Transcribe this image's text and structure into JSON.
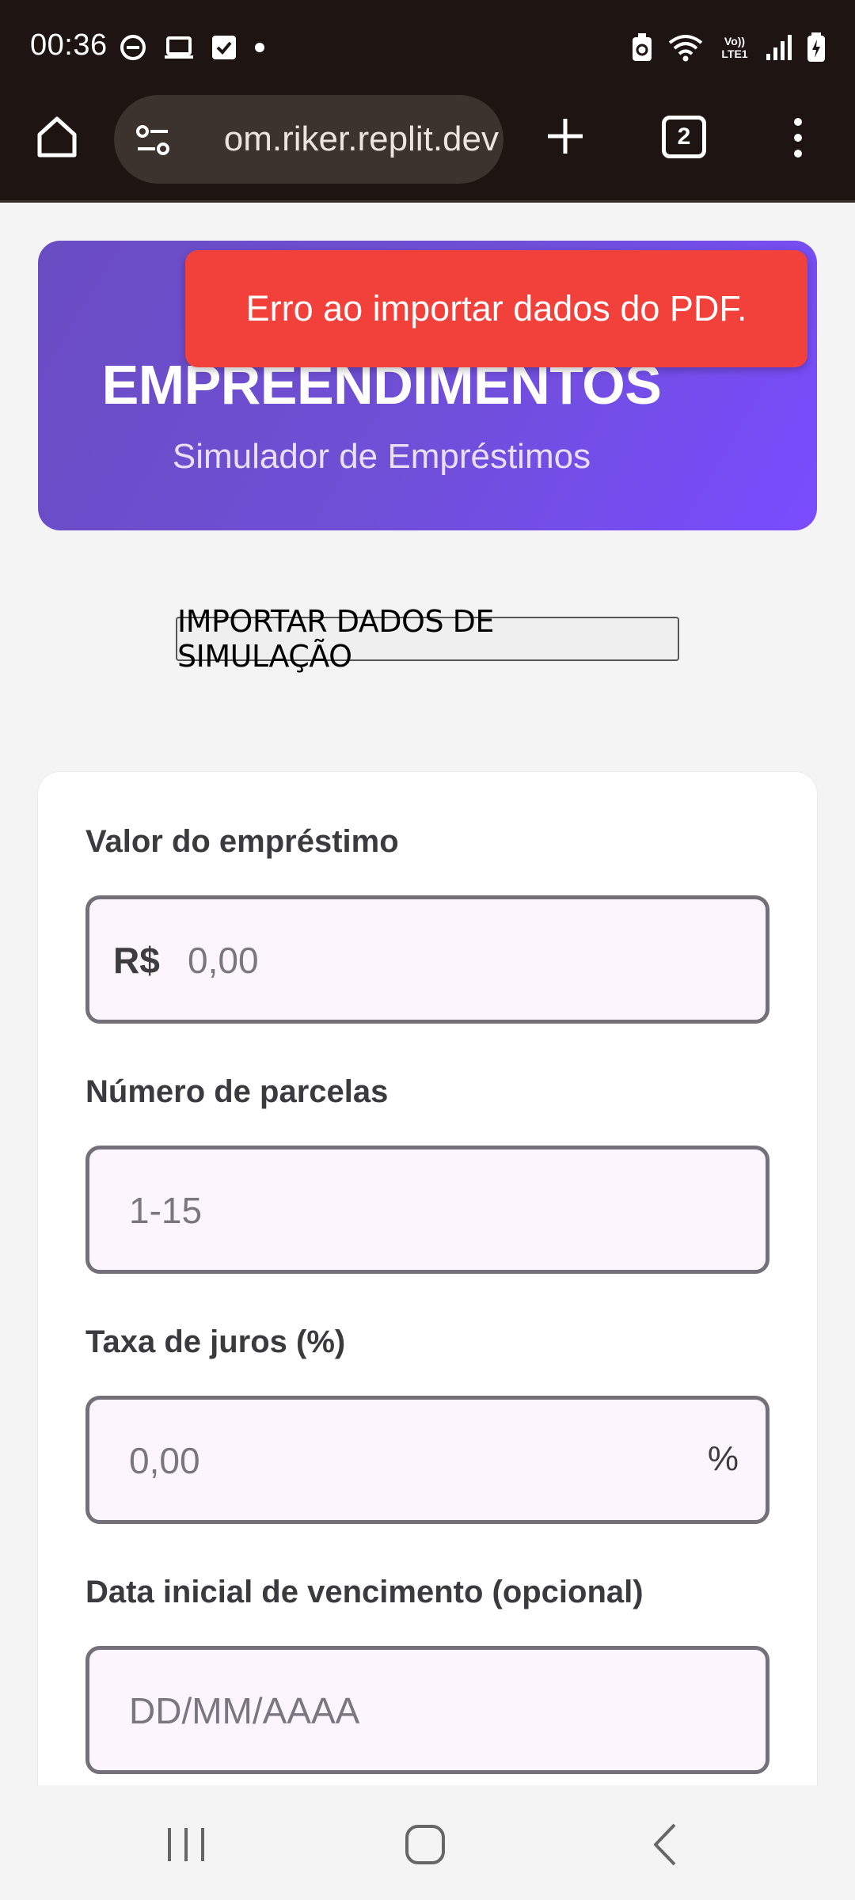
{
  "status_bar": {
    "time": "00:36",
    "left_icons": [
      "do-not-disturb-icon",
      "laptop-icon",
      "checkbox-icon",
      "dot-icon"
    ],
    "right_icons": [
      "battery-saver-icon",
      "wifi-icon",
      "volte-icon",
      "signal-icon",
      "battery-icon"
    ],
    "volte_label": "Vo)) LTE1"
  },
  "browser": {
    "url": "om.riker.replit.dev",
    "tab_count": "2"
  },
  "hero": {
    "title": "EMPREENDIMENTOS",
    "subtitle": "Simulador de Empréstimos"
  },
  "toast": {
    "message": "Erro ao importar dados do PDF."
  },
  "import_button": {
    "label": "IMPORTAR DADOS DE SIMULAÇÃO"
  },
  "form": {
    "loan_value": {
      "label": "Valor do empréstimo",
      "prefix": "R$",
      "placeholder": "0,00"
    },
    "installments": {
      "label": "Número de parcelas",
      "placeholder": "1-15"
    },
    "interest": {
      "label": "Taxa de juros (%)",
      "placeholder": "0,00",
      "suffix": "%"
    },
    "due_date": {
      "label": "Data inicial de vencimento (opcional)",
      "placeholder": "DD/MM/AAAA"
    }
  },
  "colors": {
    "hero_gradient_start": "#6a4cc2",
    "hero_gradient_end": "#7a4cff",
    "toast_background": "#f2413a",
    "input_background": "#fdf5fd",
    "toolbar_background": "#1e1512"
  }
}
